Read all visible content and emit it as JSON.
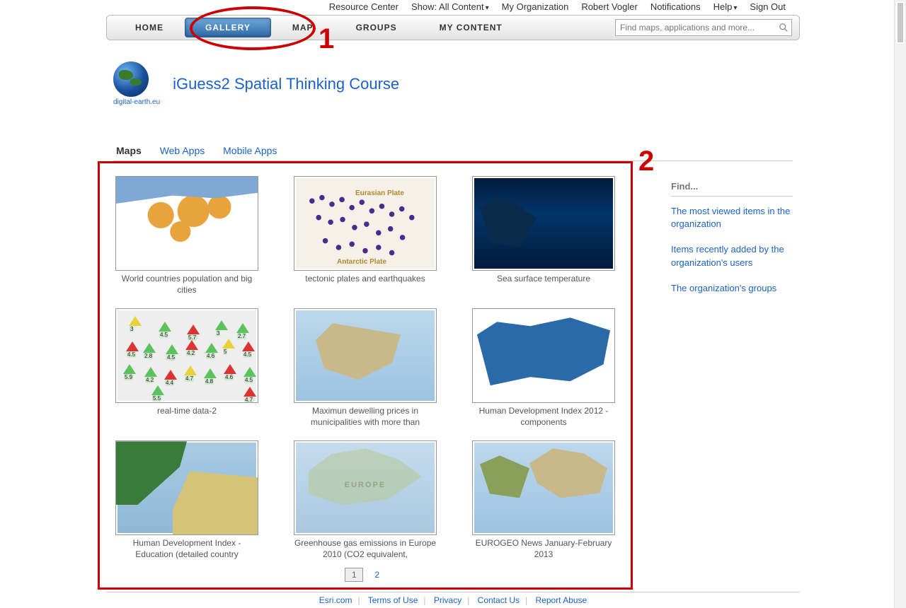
{
  "topbar": {
    "resource_center": "Resource Center",
    "show_label": "Show: All Content",
    "my_org": "My Organization",
    "user": "Robert Vogler",
    "notifications": "Notifications",
    "help": "Help",
    "sign_out": "Sign Out"
  },
  "nav": {
    "home": "HOME",
    "gallery": "GALLERY",
    "map": "MAP",
    "groups": "GROUPS",
    "my_content": "MY CONTENT"
  },
  "search": {
    "placeholder": "Find maps, applications and more..."
  },
  "brand": {
    "logo_caption": "digital-earth.eu",
    "title": "iGuess2 Spatial Thinking Course"
  },
  "subnav": {
    "maps": "Maps",
    "web_apps": "Web Apps",
    "mobile_apps": "Mobile Apps"
  },
  "annotations": {
    "one": "1",
    "two": "2"
  },
  "gallery": {
    "items": [
      {
        "title": "World countries population and big cities"
      },
      {
        "title": "tectonic plates and earthquakes",
        "label_top": "Eurasian Plate",
        "label_bottom": "Antarctic Plate"
      },
      {
        "title": "Sea surface temperature"
      },
      {
        "title": "real-time data-2"
      },
      {
        "title": "Maximun dewelling prices in municipalities with more than"
      },
      {
        "title": "Human Development Index 2012 - components"
      },
      {
        "title": "Human Development Index - Education (detailed country"
      },
      {
        "title": "Greenhouse gas emissions in Europe 2010 (CO2 equivalent,"
      },
      {
        "title": "EUROGEO News January-February 2013"
      }
    ],
    "pager": {
      "current": "1",
      "next": "2"
    }
  },
  "sidebar": {
    "heading": "Find...",
    "links": [
      "The most viewed items in the organization",
      "Items recently added by the organization's users",
      "The organization's groups"
    ]
  },
  "footer": {
    "links": [
      "Esri.com",
      "Terms of Use",
      "Privacy",
      "Contact Us",
      "Report Abuse"
    ]
  },
  "t4_markers": [
    "3",
    "4.5",
    "5.7",
    "3",
    "2.7",
    "4.5",
    "2.8",
    "4.5",
    "4.2",
    "4.6",
    "5",
    "4.5",
    "5.9",
    "4.2",
    "4.4",
    "4.7",
    "4.8",
    "4.6",
    "4.5",
    "5.5",
    "4.7"
  ]
}
